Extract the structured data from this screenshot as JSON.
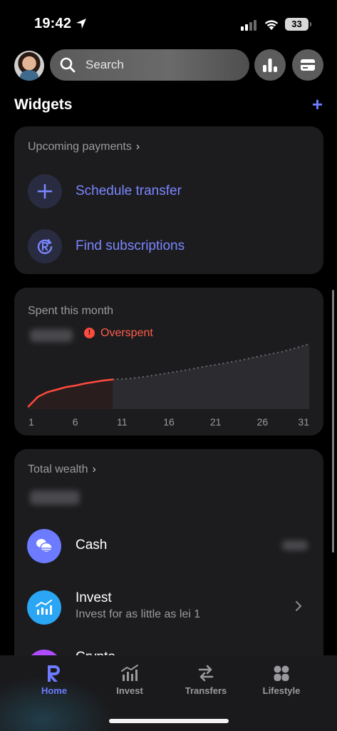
{
  "status_bar": {
    "time": "19:42",
    "battery": "33"
  },
  "header": {
    "search_placeholder": "Search",
    "icons": [
      "avatar",
      "search-icon",
      "analytics-icon",
      "card-icon"
    ]
  },
  "widgets": {
    "title": "Widgets",
    "add_label": "+"
  },
  "upcoming": {
    "label": "Upcoming payments",
    "chevron": "›",
    "actions": [
      {
        "label": "Schedule transfer",
        "icon": "plus-icon"
      },
      {
        "label": "Find subscriptions",
        "icon": "subscription-icon"
      }
    ]
  },
  "spent": {
    "label": "Spent this month",
    "status": "Overspent",
    "status_icon": "!",
    "amount": "hidden",
    "colors": {
      "spent_line": "#ff4a3d",
      "projection": "#6c6c70"
    }
  },
  "chart_data": {
    "type": "line",
    "x_ticks": [
      "1",
      "6",
      "11",
      "16",
      "21",
      "26",
      "31"
    ],
    "series": [
      {
        "values": [
          [
            1,
            0.05
          ],
          [
            2,
            0.24
          ],
          [
            3,
            0.33
          ],
          [
            4,
            0.38
          ],
          [
            5,
            0.43
          ],
          [
            6,
            0.46
          ],
          [
            7,
            0.5
          ],
          [
            8,
            0.53
          ],
          [
            9,
            0.56
          ],
          [
            10,
            0.58
          ]
        ]
      },
      {
        "values": [
          [
            10,
            0.58
          ],
          [
            12,
            0.6
          ],
          [
            14,
            0.65
          ],
          [
            16,
            0.71
          ],
          [
            18,
            0.77
          ],
          [
            20,
            0.84
          ],
          [
            22,
            0.9
          ],
          [
            24,
            0.97
          ],
          [
            26,
            1.05
          ],
          [
            28,
            1.12
          ],
          [
            30,
            1.22
          ],
          [
            31,
            1.28
          ]
        ]
      }
    ],
    "xlim": [
      1,
      31
    ],
    "ylim": [
      0,
      1.4
    ],
    "grid": false
  },
  "wealth": {
    "label": "Total wealth",
    "chevron": "›",
    "items": [
      {
        "title": "Cash",
        "icon": "coins-icon",
        "color": "#6c7bff"
      },
      {
        "title": "Invest",
        "subtitle": "Invest for as little as lei 1",
        "icon": "invest-chart-icon",
        "color": "#2aa6f5"
      },
      {
        "title": "Crypto",
        "icon": "crypto-icon",
        "color": "#b04cff"
      }
    ]
  },
  "tabs": [
    {
      "label": "Home",
      "icon": "revolut-r-icon",
      "active": true
    },
    {
      "label": "Invest",
      "icon": "invest-icon",
      "active": false
    },
    {
      "label": "Transfers",
      "icon": "transfers-icon",
      "active": false
    },
    {
      "label": "Lifestyle",
      "icon": "lifestyle-icon",
      "active": false
    }
  ]
}
